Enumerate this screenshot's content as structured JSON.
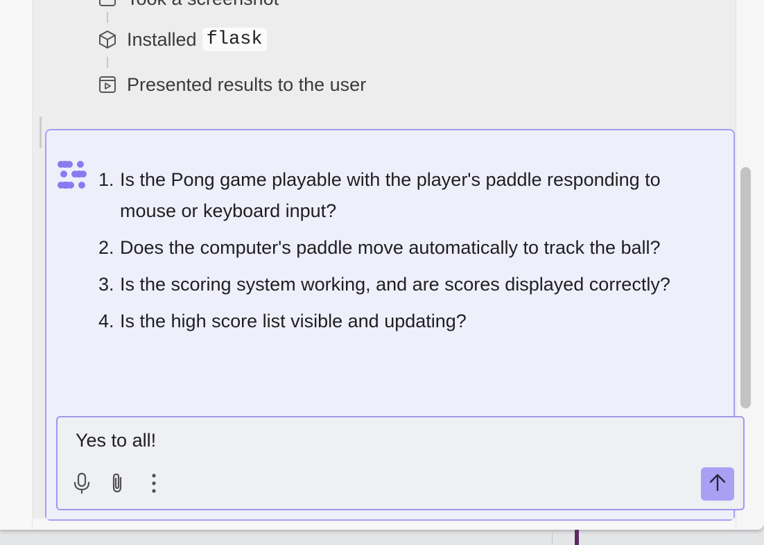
{
  "activity": {
    "steps": [
      {
        "icon": "screenshot-icon",
        "label": "Took a screenshot"
      },
      {
        "icon": "package-icon",
        "label": "Installed",
        "code": "flask"
      },
      {
        "icon": "present-icon",
        "label": "Presented results to the user"
      }
    ]
  },
  "message": {
    "questions": [
      {
        "num": "1.",
        "text": "Is the Pong game playable with the player's paddle responding to mouse or keyboard input?"
      },
      {
        "num": "2.",
        "text": "Does the computer's paddle move automatically to track the ball?"
      },
      {
        "num": "3.",
        "text": "Is the scoring system working, and are scores displayed correctly?"
      },
      {
        "num": "4.",
        "text": "Is the high score list visible and updating?"
      }
    ]
  },
  "composer": {
    "value": "Yes to all!",
    "tools": [
      "microphone-icon",
      "paperclip-icon",
      "more-vertical-icon"
    ],
    "send_icon": "arrow-up-icon"
  },
  "colors": {
    "accent": "#a9a0f4",
    "bubble_border": "#a79ef2",
    "logo": "#8a7af0"
  }
}
